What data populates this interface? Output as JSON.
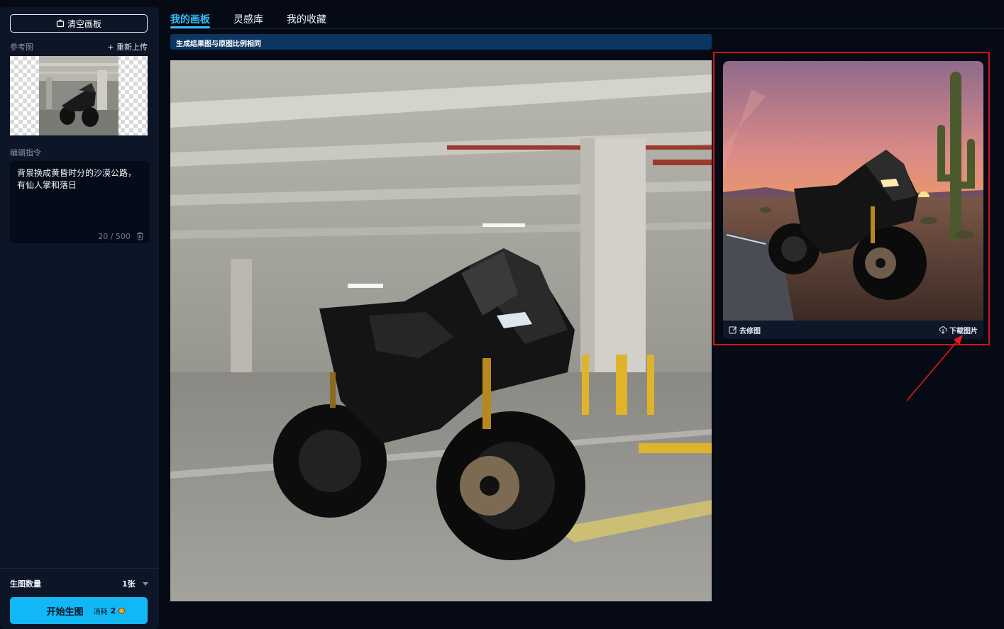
{
  "sidebar": {
    "clear_button": "清空画板",
    "reference_label": "参考图",
    "reupload_label": "+ 重新上传",
    "instruction_label": "编辑指令",
    "instruction_text": "背景换成黄昏时分的沙漠公路，有仙人掌和落日",
    "char_count": "20 / 500",
    "count_label": "生图数量",
    "count_value": "1张",
    "start_button": "开始生图",
    "cost_label": "消耗",
    "cost_value": "2"
  },
  "tabs": [
    {
      "label": "我的画板",
      "active": true
    },
    {
      "label": "灵感库",
      "active": false
    },
    {
      "label": "我的收藏",
      "active": false
    }
  ],
  "notice": "生成结果图与原图比例相同",
  "result_card": {
    "retouch_label": "去修图",
    "download_label": "下载图片"
  },
  "colors": {
    "accent": "#11b8f5",
    "highlight": "#d4111a"
  }
}
